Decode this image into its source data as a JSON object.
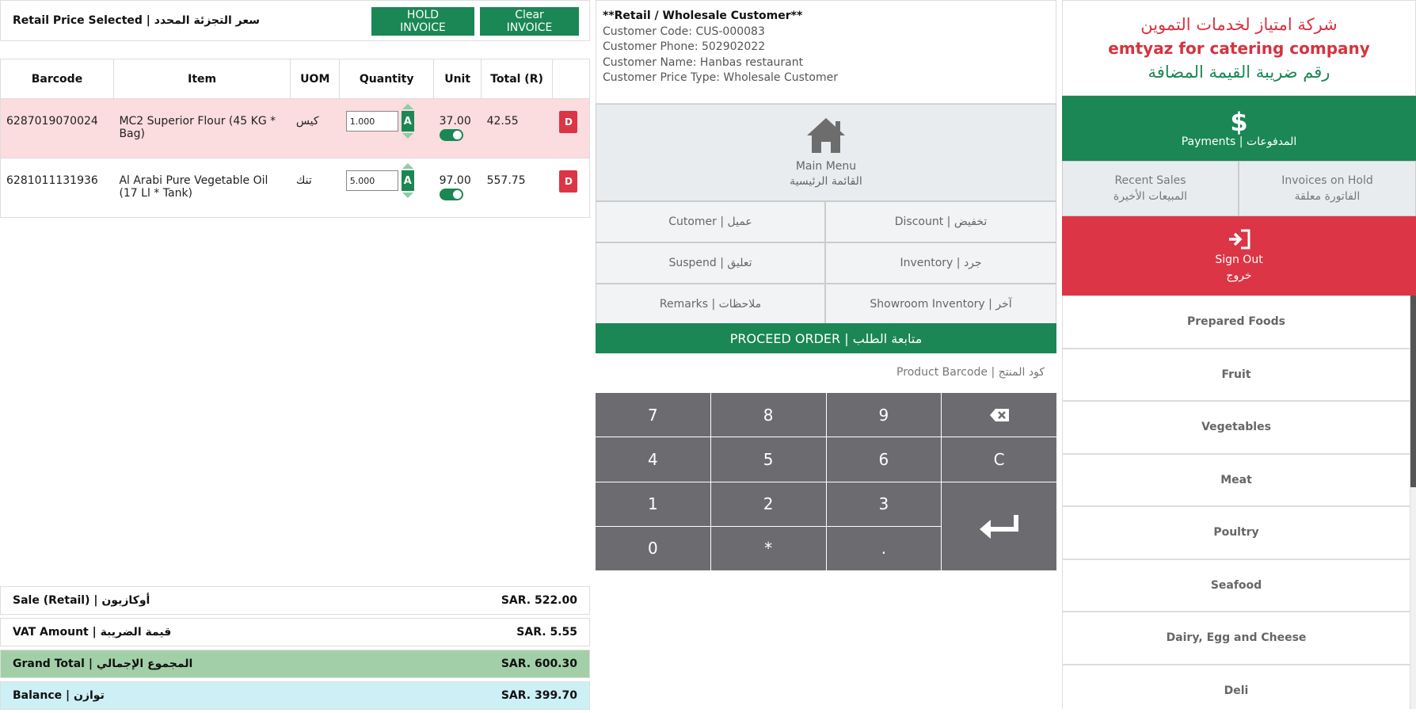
{
  "header": {
    "price_mode": "Retail Price Selected | سعر التجزئة المحدد",
    "hold_label": "HOLD INVOICE",
    "clear_label": "Clear INVOICE"
  },
  "table": {
    "columns": [
      "Barcode",
      "Item",
      "UOM",
      "Quantity",
      "Unit",
      "Total (R)",
      ""
    ],
    "rows": [
      {
        "barcode": "6287019070024",
        "item": "MC2 Superior Flour (45 KG * Bag)",
        "uom": "كيس",
        "qty": "1.000",
        "a": "A",
        "unit": "37.00",
        "total": "42.55",
        "del": "D",
        "highlight": true
      },
      {
        "barcode": "6281011131936",
        "item": "Al Arabi Pure Vegetable Oil (17 Ll * Tank)",
        "uom": "تنك",
        "qty": "5.000",
        "a": "A",
        "unit": "97.00",
        "total": "557.75",
        "del": "D",
        "highlight": false
      }
    ]
  },
  "totals": {
    "sale_label": "Sale (Retail) | أوكازيون",
    "sale_value": "SAR. 522.00",
    "vat_label": "VAT Amount | قيمة الضريبة",
    "vat_value": "SAR. 5.55",
    "grand_label": "Grand Total | المجموع الإجمالي",
    "grand_value": "SAR. 600.30",
    "balance_label": "Balance | توازن",
    "balance_value": "SAR. 399.70"
  },
  "customer": {
    "type": "**Retail / Wholesale Customer**",
    "code": "Customer Code: CUS-000083",
    "phone": "Customer Phone: 502902022",
    "name": "Customer Name: Hanbas restaurant",
    "price_type": "Customer Price Type: Wholesale Customer"
  },
  "main_menu": {
    "en": "Main Menu",
    "ar": "القائمة الرئيسية",
    "icon": "home-icon"
  },
  "actions": {
    "customer": "Cutomer | عميل",
    "discount": "Discount | تخفيض",
    "suspend": "Suspend | تعليق",
    "inventory": "Inventory | جرد",
    "remarks": "Remarks | ملاحظات",
    "showroom": "Showroom Inventory | آخر",
    "proceed": "PROCEED ORDER | متابعة الطلب"
  },
  "barcode_label": "Product Barcode | كود المنتج",
  "keypad": {
    "k7": "7",
    "k8": "8",
    "k9": "9",
    "k4": "4",
    "k5": "5",
    "k6": "6",
    "kC": "C",
    "k1": "1",
    "k2": "2",
    "k3": "3",
    "k0": "0",
    "kstar": "*",
    "kdot": "."
  },
  "company": {
    "ar_name": "شركة امتياز لخدمات التموين",
    "en_name": "emtyaz for catering company",
    "vat": "رقم ضريبة القيمة المضافة"
  },
  "payments": {
    "symbol": "$",
    "label": "Payments | المدفوعات"
  },
  "recent_sales": {
    "en": "Recent Sales",
    "ar": "المبيعات الأخيرة"
  },
  "invoices_hold": {
    "en": "Invoices on Hold",
    "ar": "الفاتورة معلقة"
  },
  "signout": {
    "en": "Sign Out",
    "ar": "خروج"
  },
  "categories": [
    "Prepared Foods",
    "Fruit",
    "Vegetables",
    "Meat",
    "Poultry",
    "Seafood",
    "Dairy, Egg and Cheese",
    "Deli"
  ],
  "colors": {
    "green": "#1a8754",
    "red": "#dc3545",
    "keypad": "#6c6c70",
    "row_highlight": "#fbdcdf",
    "grand_total": "#a3cfa8",
    "balance": "#cdf0f6"
  }
}
